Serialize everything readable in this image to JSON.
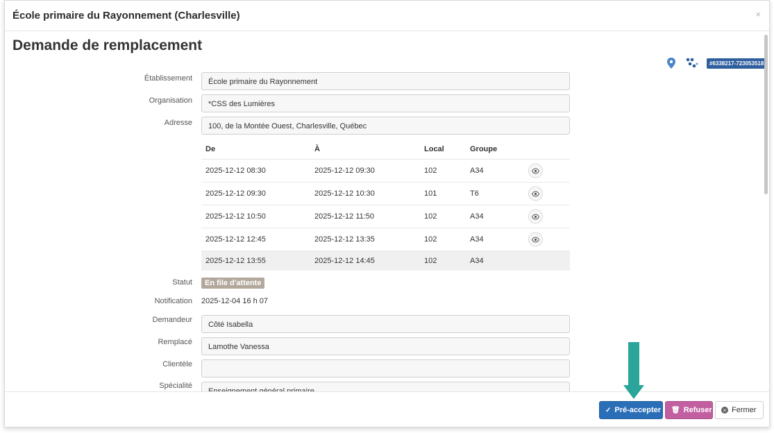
{
  "header": {
    "title": "École primaire du Rayonnement (Charlesville)",
    "close_glyph": "×"
  },
  "page_title": "Demande de remplacement",
  "reference_badge": "#6338217-723053518",
  "icons": {
    "location": "map-pin-icon",
    "network": "nodes-icon",
    "eye": "eye-icon"
  },
  "fields": {
    "etablissement": {
      "label": "Établissement",
      "value": "École primaire du Rayonnement"
    },
    "organisation": {
      "label": "Organisation",
      "value": "*CSS des Lumières"
    },
    "adresse": {
      "label": "Adresse",
      "value": "100, de la Montée Ouest, Charlesville, Québec"
    }
  },
  "schedule": {
    "headers": {
      "de": "De",
      "a": "À",
      "local": "Local",
      "groupe": "Groupe"
    },
    "rows": [
      {
        "de": "2025-12-12 08:30",
        "a": "2025-12-12 09:30",
        "local": "102",
        "groupe": "A34",
        "has_view": true
      },
      {
        "de": "2025-12-12 09:30",
        "a": "2025-12-12 10:30",
        "local": "101",
        "groupe": "T6",
        "has_view": true
      },
      {
        "de": "2025-12-12 10:50",
        "a": "2025-12-12 11:50",
        "local": "102",
        "groupe": "A34",
        "has_view": true
      },
      {
        "de": "2025-12-12 12:45",
        "a": "2025-12-12 13:35",
        "local": "102",
        "groupe": "A34",
        "has_view": true
      },
      {
        "de": "2025-12-12 13:55",
        "a": "2025-12-12 14:45",
        "local": "102",
        "groupe": "A34",
        "has_view": false
      }
    ]
  },
  "statut": {
    "label": "Statut",
    "value": "En file d'attente",
    "color": "#b3a89c"
  },
  "notification": {
    "label": "Notification",
    "value": "2025-12-04 16 h 07"
  },
  "demandeur": {
    "label": "Demandeur",
    "value": "Côté Isabella"
  },
  "remplace": {
    "label": "Remplacé",
    "value": "Lamothe Vanessa"
  },
  "clientele": {
    "label": "Clientèle",
    "value": ""
  },
  "specialite": {
    "label": "Spécialité",
    "value": "Enseignement général primaire"
  },
  "footer": {
    "accept_label": "Pré-accepter",
    "refuse_label": "Refuser",
    "close_label": "Fermer",
    "accept_color": "#2a6eb8",
    "refuse_color": "#c15fa0"
  },
  "annotation_arrow_color": "#2aa59a"
}
